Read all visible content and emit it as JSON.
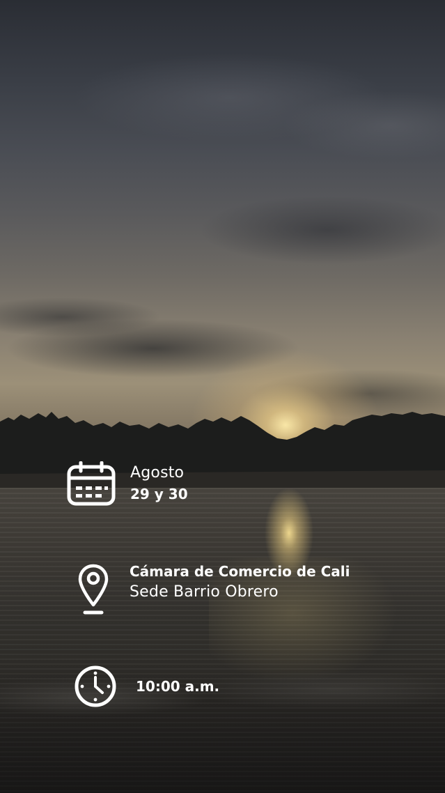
{
  "event": {
    "date": {
      "icon": "calendar-icon",
      "month": "Agosto",
      "days": "29 y 30"
    },
    "location": {
      "icon": "map-pin-icon",
      "venue": "Cámara de Comercio de Cali",
      "branch": "Sede Barrio Obrero"
    },
    "time": {
      "icon": "clock-icon",
      "value": "10:00 a.m."
    }
  },
  "colors": {
    "text": "#ffffff",
    "icon": "#ffffff"
  }
}
